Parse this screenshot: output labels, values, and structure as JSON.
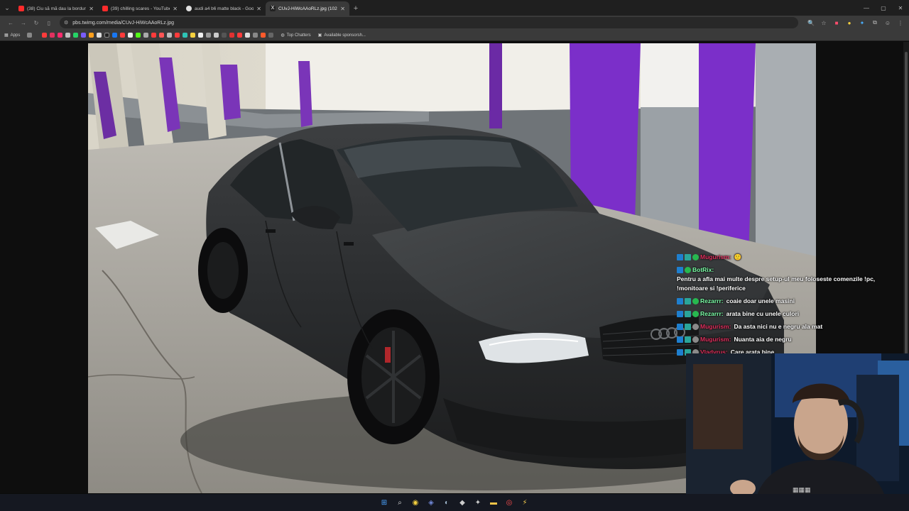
{
  "browser": {
    "tabs": [
      {
        "title": "(38) Ciu să mă dau la borduri",
        "favicon_color": "#ff2b2b",
        "active": false
      },
      {
        "title": "(39) chilling scares - YouTube",
        "favicon_color": "#ff2b2b",
        "active": false
      },
      {
        "title": "audi a4 b6 matte black - Google",
        "favicon_color": "#e0e0e0",
        "active": false
      },
      {
        "title": "CUvJ-HiWcAAoRLz.jpg (1024×...",
        "favicon_color": "#dddddd",
        "active": true
      }
    ],
    "new_tab_label": "+",
    "url": "pbs.twimg.com/media/CUvJ-HiWcAAoRLz.jpg",
    "bookmarks": {
      "apps_label": "Apps",
      "top_chatters_label": "Top Chatters",
      "available_label": "Available sponsorsh..."
    }
  },
  "chat": {
    "messages": [
      {
        "user": "Mugurism:",
        "user_color": "#e0315f",
        "text": "🙂",
        "badges": [
          "b1",
          "b2",
          "b3"
        ]
      },
      {
        "user": "BotRix:",
        "user_color": "#7cffa8",
        "text": "Pentru a afla mai multe despre setup-ul meu foloseste comenzile !pc, !monitoare si !periferice",
        "badges": [
          "b1",
          "b3"
        ]
      },
      {
        "user": "Rezarrr:",
        "user_color": "#7cffa8",
        "text": "coaie doar unele masini",
        "badges": [
          "b1",
          "b2",
          "b3"
        ]
      },
      {
        "user": "Rezarrr:",
        "user_color": "#7cffa8",
        "text": "arata bine cu unele culori",
        "badges": [
          "b1",
          "b2",
          "b3"
        ]
      },
      {
        "user": "Mugurism:",
        "user_color": "#e0315f",
        "text": "Da asta nici nu e negru ala mat",
        "badges": [
          "b1",
          "b2",
          "b3"
        ]
      },
      {
        "user": "Mugurism:",
        "user_color": "#e0315f",
        "text": "Nuanta aia de negru",
        "badges": [
          "b1",
          "b2",
          "b3"
        ]
      },
      {
        "user": "Vladyrus:",
        "user_color": "#e0315f",
        "text": "Care arata bine",
        "badges": [
          "b1",
          "b2",
          "b3"
        ]
      }
    ]
  }
}
